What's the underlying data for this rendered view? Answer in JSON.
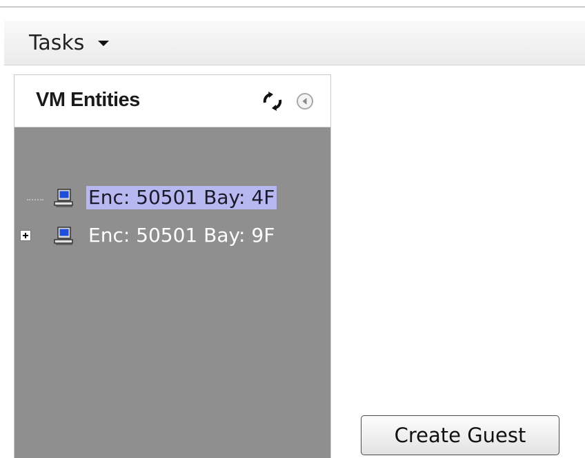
{
  "toolbar": {
    "tasks_label": "Tasks",
    "tasks_icon": "dropdown-arrow-icon"
  },
  "panel": {
    "title": "VM Entities",
    "header_icons": [
      "refresh-icon",
      "collapse-left-icon"
    ],
    "tree": [
      {
        "label": "Enc: 50501 Bay: 4F",
        "icon": "computer-icon",
        "selected": true,
        "expandable": false
      },
      {
        "label": "Enc: 50501 Bay: 9F",
        "icon": "computer-icon",
        "selected": false,
        "expandable": true
      }
    ]
  },
  "actions": {
    "create_guest_label": "Create Guest"
  },
  "colors": {
    "panel_background": "#8f8f8f",
    "selection_highlight": "#b8b8f0",
    "toolbar_background": "#f0f0f0"
  }
}
